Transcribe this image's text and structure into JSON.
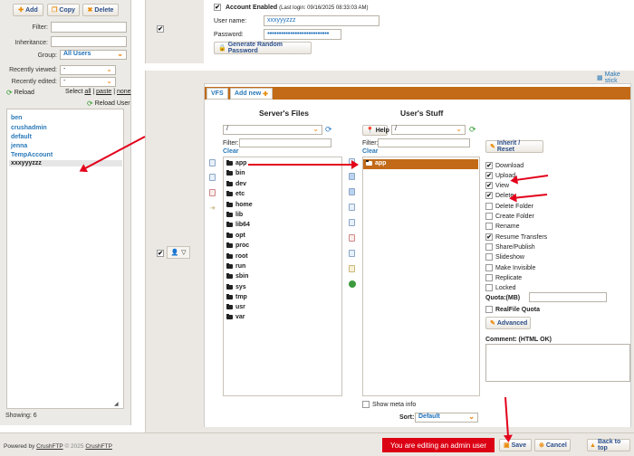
{
  "left": {
    "buttons": {
      "add": "Add",
      "copy": "Copy",
      "delete": "Delete"
    },
    "filter_label": "Filter:",
    "inheritance_label": "Inheritance:",
    "group_label": "Group:",
    "group_value": "All Users",
    "recently_viewed_label": "Recently viewed:",
    "recently_viewed_value": "-",
    "recently_edited_label": "Recently edited:",
    "recently_edited_value": "-",
    "reload_label": "Reload",
    "select_label": "Select",
    "select_all": "all",
    "select_paste": "paste",
    "select_none": "none",
    "reload_user_label": "Reload User",
    "users": [
      "ben",
      "crushadmin",
      "default",
      "jenna",
      "TempAccount",
      "xxxyyyzzz"
    ],
    "showing": "Showing: 6"
  },
  "top": {
    "account_enabled": "Account Enabled",
    "last_login": "(Last login: 09/16/2025 08:33:03 AM)",
    "username_label": "User name:",
    "username_value": "xxxyyyzzz",
    "password_label": "Password:",
    "password_value": "●●●●●●●●●●●●●●●●●●●●●●●●●●●",
    "generate_label": "Generate Random Password",
    "make_sticky": "Make stick"
  },
  "tabs": {
    "vfs": "VFS",
    "add_new": "Add new"
  },
  "server": {
    "title": "Server's Files",
    "path": "/",
    "filter_label": "Filter:",
    "clear": "Clear",
    "folders": [
      "app",
      "bin",
      "dev",
      "etc",
      "home",
      "lib",
      "lib64",
      "opt",
      "proc",
      "root",
      "run",
      "sbin",
      "sys",
      "tmp",
      "usr",
      "var"
    ]
  },
  "user": {
    "title": "User's Stuff",
    "help": "Help",
    "path": "/",
    "filter_label": "Filter:",
    "clear": "Clear",
    "folders": [
      "app"
    ],
    "show_meta": "Show meta info",
    "sort_label": "Sort:",
    "sort_value": "Default"
  },
  "perms": {
    "inherit_reset": "Inherit / Reset",
    "items": [
      {
        "label": "Download",
        "checked": "✔"
      },
      {
        "label": "Upload",
        "checked": "✔"
      },
      {
        "label": "View",
        "checked": "✔"
      },
      {
        "label": "Delete",
        "checked": "✔"
      },
      {
        "label": "Delete Folder",
        "checked": ""
      },
      {
        "label": "Create Folder",
        "checked": ""
      },
      {
        "label": "Rename",
        "checked": ""
      },
      {
        "label": "Resume Transfers",
        "checked": "✔"
      },
      {
        "label": "Share/Publish",
        "checked": ""
      },
      {
        "label": "Slideshow",
        "checked": ""
      },
      {
        "label": "Make Invisible",
        "checked": ""
      },
      {
        "label": "Replicate",
        "checked": ""
      },
      {
        "label": "Locked",
        "checked": ""
      }
    ],
    "quota_label": "Quota:(MB)",
    "realfile_label": "RealFile Quota",
    "advanced": "Advanced",
    "comment_label": "Comment: (HTML OK)"
  },
  "footer": {
    "powered": "Powered by",
    "crushftp": "CrushFTP",
    "copyright": "© 2025",
    "crushftp2": "CrushFTP",
    "alert": "You are editing an admin user",
    "save": "Save",
    "cancel": "Cancel",
    "back_to_top": "Back to top"
  },
  "colors": {
    "accent": "#c26a17",
    "link": "#2a79b8",
    "alert": "#dc0014",
    "arrow": "#e3001b"
  }
}
